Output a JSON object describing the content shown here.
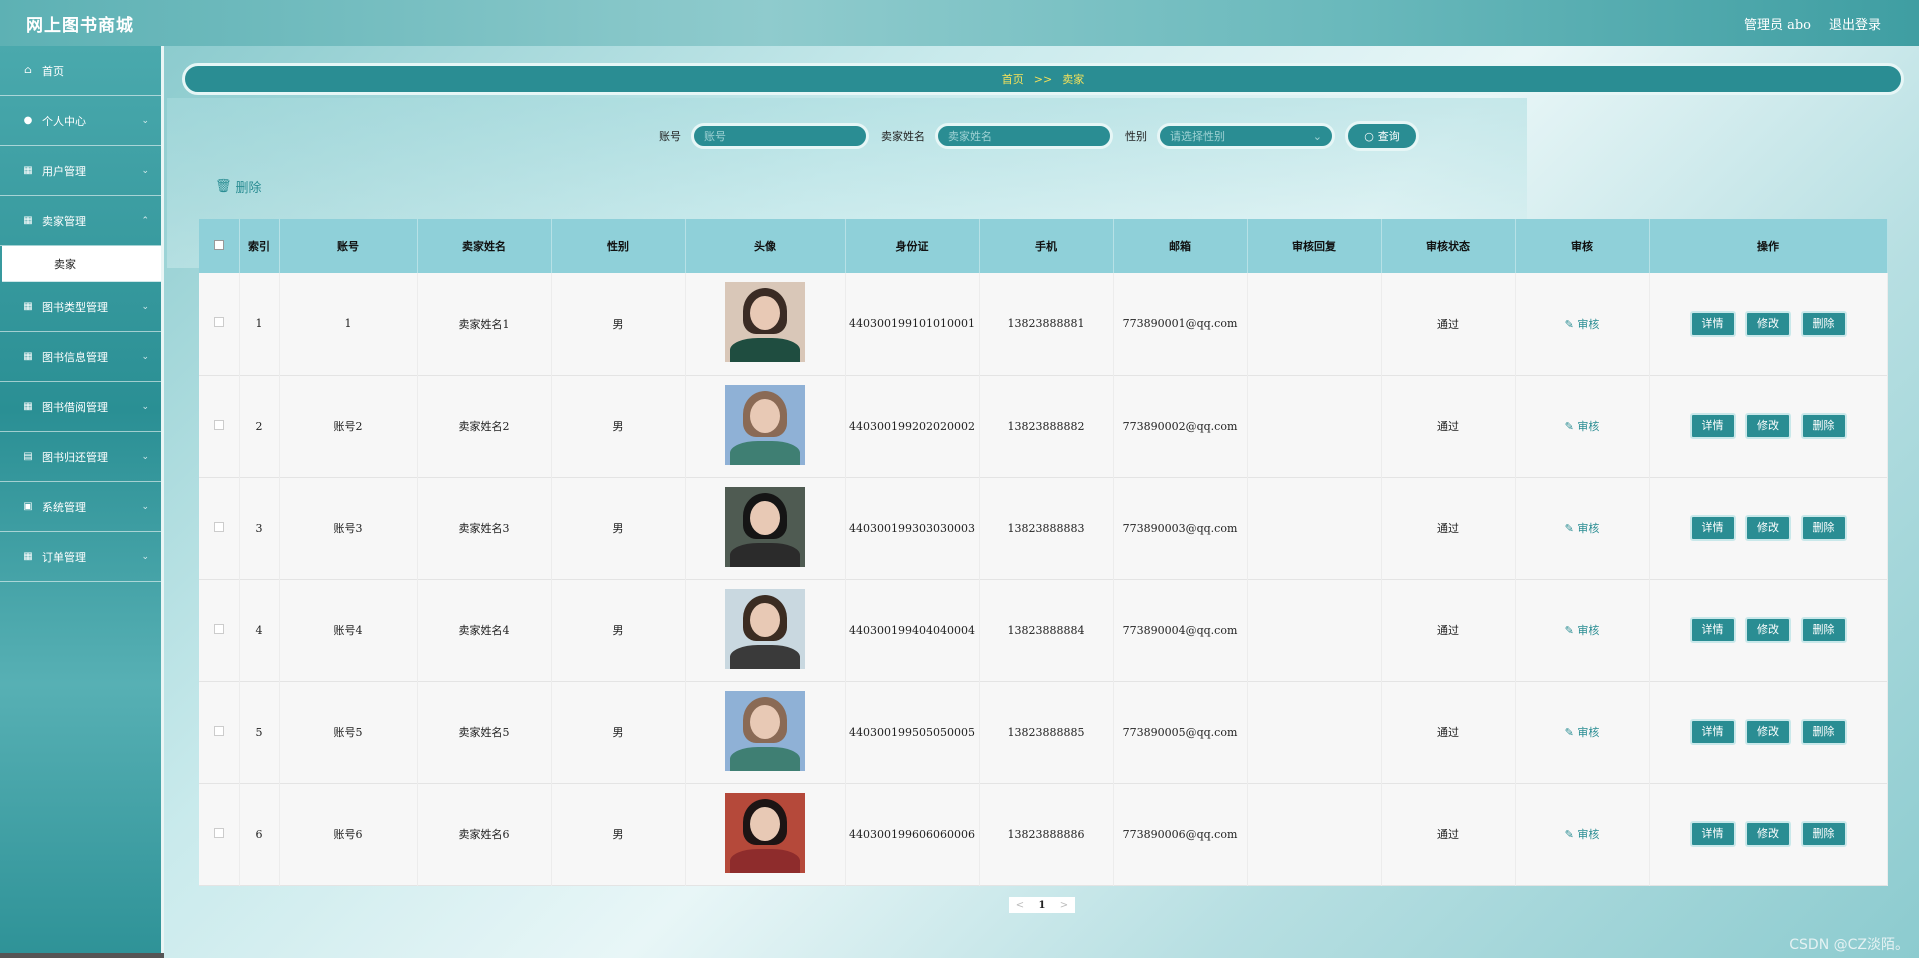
{
  "header": {
    "brand": "网上图书商城",
    "admin_label": "管理员 abo",
    "logout_label": "退出登录"
  },
  "sidebar": {
    "items": [
      {
        "label": "首页",
        "icon": "home-icon"
      },
      {
        "label": "个人中心",
        "icon": "user-icon"
      },
      {
        "label": "用户管理",
        "icon": "grid-icon"
      },
      {
        "label": "卖家管理",
        "icon": "grid-icon",
        "sub": "卖家"
      },
      {
        "label": "图书类型管理",
        "icon": "grid-icon"
      },
      {
        "label": "图书信息管理",
        "icon": "grid-icon"
      },
      {
        "label": "图书借阅管理",
        "icon": "grid-icon"
      },
      {
        "label": "图书归还管理",
        "icon": "calendar-icon"
      },
      {
        "label": "系统管理",
        "icon": "calendar-check-icon"
      },
      {
        "label": "订单管理",
        "icon": "grid-icon"
      }
    ]
  },
  "breadcrumb": {
    "home": "首页",
    "sep": ">>",
    "current": "卖家"
  },
  "search": {
    "account_label": "账号",
    "account_placeholder": "账号",
    "name_label": "卖家姓名",
    "name_placeholder": "卖家姓名",
    "gender_label": "性别",
    "gender_placeholder": "请选择性别",
    "query_label": "查询"
  },
  "toolbar": {
    "delete_label": "删除"
  },
  "table": {
    "headers": [
      "",
      "索引",
      "账号",
      "卖家姓名",
      "性别",
      "头像",
      "身份证",
      "手机",
      "邮箱",
      "审核回复",
      "审核状态",
      "审核",
      "操作"
    ],
    "rows": [
      {
        "index": "1",
        "account": "1",
        "name": "卖家姓名1",
        "gender": "男",
        "id_card": "440300199101010001",
        "phone": "13823888881",
        "email": "773890001@qq.com",
        "reply": "",
        "status": "通过",
        "avatar": {
          "hair": "#3a2b24",
          "body": "#1f4d40",
          "bg": "#d9c7b8"
        }
      },
      {
        "index": "2",
        "account": "账号2",
        "name": "卖家姓名2",
        "gender": "男",
        "id_card": "440300199202020002",
        "phone": "13823888882",
        "email": "773890002@qq.com",
        "reply": "",
        "status": "通过",
        "avatar": {
          "hair": "#8a6a55",
          "body": "#3f7f73",
          "bg": "#8fb1d6"
        }
      },
      {
        "index": "3",
        "account": "账号3",
        "name": "卖家姓名3",
        "gender": "男",
        "id_card": "440300199303030003",
        "phone": "13823888883",
        "email": "773890003@qq.com",
        "reply": "",
        "status": "通过",
        "avatar": {
          "hair": "#151515",
          "body": "#2b2b2b",
          "bg": "#4f5b52"
        }
      },
      {
        "index": "4",
        "account": "账号4",
        "name": "卖家姓名4",
        "gender": "男",
        "id_card": "440300199404040004",
        "phone": "13823888884",
        "email": "773890004@qq.com",
        "reply": "",
        "status": "通过",
        "avatar": {
          "hair": "#3b2c22",
          "body": "#3a3a3a",
          "bg": "#c9d8e0"
        }
      },
      {
        "index": "5",
        "account": "账号5",
        "name": "卖家姓名5",
        "gender": "男",
        "id_card": "440300199505050005",
        "phone": "13823888885",
        "email": "773890005@qq.com",
        "reply": "",
        "status": "通过",
        "avatar": {
          "hair": "#8a6a55",
          "body": "#3f7f73",
          "bg": "#8fb1d6"
        }
      },
      {
        "index": "6",
        "account": "账号6",
        "name": "卖家姓名6",
        "gender": "男",
        "id_card": "440300199606060006",
        "phone": "13823888886",
        "email": "773890006@qq.com",
        "reply": "",
        "status": "通过",
        "avatar": {
          "hair": "#1c1414",
          "body": "#8e2c2c",
          "bg": "#b5493a"
        }
      }
    ],
    "audit_label": "审核",
    "op_detail": "详情",
    "op_edit": "修改",
    "op_delete": "删除"
  },
  "pager": {
    "prev": "<",
    "current": "1",
    "next": ">"
  },
  "watermark": "CSDN @CZ淡陌。",
  "colors": {
    "accent": "#2a8d93",
    "header_row": "#8fd0d9",
    "breadcrumb_text": "#f6e25a"
  }
}
